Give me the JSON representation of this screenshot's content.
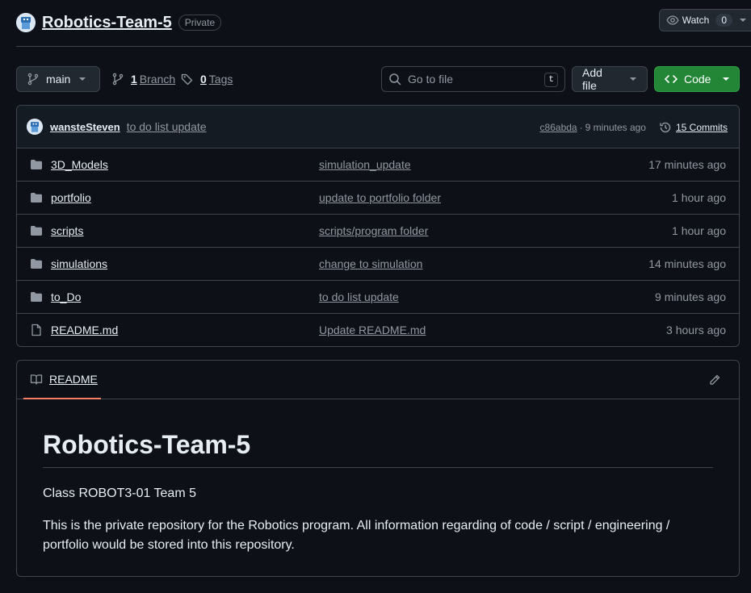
{
  "repo": {
    "name": "Robotics-Team-5",
    "visibility": "Private",
    "watch_label": "Watch",
    "watch_count": "0"
  },
  "toolbar": {
    "branch": "main",
    "branch_count": "1",
    "branch_label": "Branch",
    "tag_count": "0",
    "tag_label": "Tags",
    "search_placeholder": "Go to file",
    "search_shortcut": "t",
    "add_file_label": "Add file",
    "code_label": "Code"
  },
  "latest_commit": {
    "author": "wansteSteven",
    "message": "to do list update",
    "sha": "c86abda",
    "separator": "·",
    "time": "9 minutes ago",
    "commits_label": "15 Commits"
  },
  "files": [
    {
      "name": "3D_Models",
      "type": "folder",
      "commit": "simulation_update",
      "time": "17 minutes ago"
    },
    {
      "name": "portfolio",
      "type": "folder",
      "commit": "update to portfolio folder",
      "time": "1 hour ago"
    },
    {
      "name": "scripts",
      "type": "folder",
      "commit": "scripts/program folder",
      "time": "1 hour ago"
    },
    {
      "name": "simulations",
      "type": "folder",
      "commit": "change to simulation",
      "time": "14 minutes ago"
    },
    {
      "name": "to_Do",
      "type": "folder",
      "commit": "to do list update",
      "time": "9 minutes ago"
    },
    {
      "name": "README.md",
      "type": "file",
      "commit": "Update README.md",
      "time": "3 hours ago"
    }
  ],
  "readme": {
    "tab_label": "README",
    "heading": "Robotics-Team-5",
    "paragraph_1": "Class ROBOT3-01 Team 5",
    "paragraph_2": "This is the private repository for the Robotics program. All information regarding of code / script / engineering / portfolio would be stored into this repository."
  },
  "colors": {
    "background": "#0d1117",
    "border": "#3d444d",
    "code_button": "#238636",
    "readme_tab_accent": "#f78166",
    "muted_text": "#9198a1"
  }
}
